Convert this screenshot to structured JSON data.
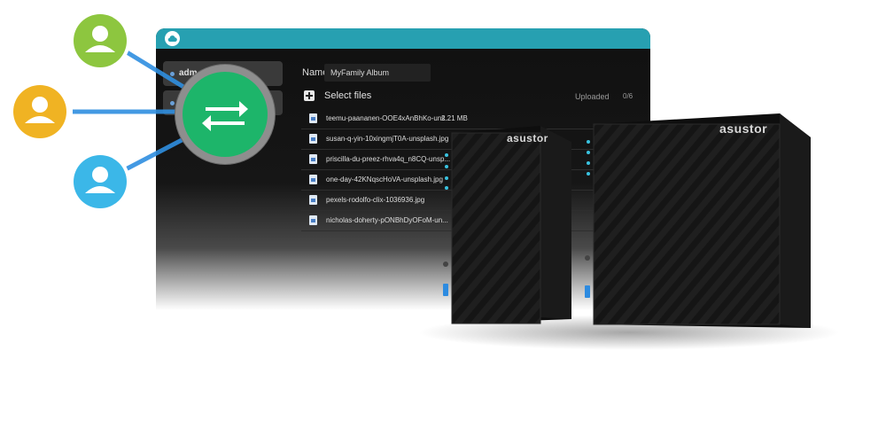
{
  "window": {
    "sidebar": {
      "items": [
        {
          "label": "adm"
        },
        {
          "label": ""
        }
      ]
    },
    "name_label": "Name",
    "name_value": "MyFamily Album",
    "select_files_label": "Select files",
    "uploaded_label": "Uploaded",
    "uploaded_count": "0/6",
    "files": [
      {
        "name": "teemu-paananen-OOE4xAnBhKo-uns...",
        "size": "2.21 MB"
      },
      {
        "name": "susan-q-yin-10xingmjT0A-unsplash.jpg",
        "size": ""
      },
      {
        "name": "priscilla-du-preez-rhva4q_n8CQ-unsp...",
        "size": ""
      },
      {
        "name": "one-day-42KNqscHoVA-unsplash.jpg",
        "size": ""
      },
      {
        "name": "pexels-rodolfo-clix-1036936.jpg",
        "size": ""
      },
      {
        "name": "nicholas-doherty-pONBhDyOFoM-un...",
        "size": ""
      }
    ]
  },
  "users": [
    {
      "name": "green-user",
      "color": "#8dc63f"
    },
    {
      "name": "yellow-user",
      "color": "#f0b323"
    },
    {
      "name": "blue-user",
      "color": "#3bb7e8"
    }
  ],
  "icons": {
    "transfer": "transfer-arrows-icon",
    "cloud": "cloud-icon",
    "add": "plus-icon",
    "file": "image-file-icon",
    "user": "user-icon"
  },
  "colors": {
    "titlebar": "#27a0b1",
    "transfer": "#1db56a",
    "connector": "#2f8fe0"
  },
  "devices": {
    "brand_left": "asustor",
    "brand_right": "asustor"
  }
}
